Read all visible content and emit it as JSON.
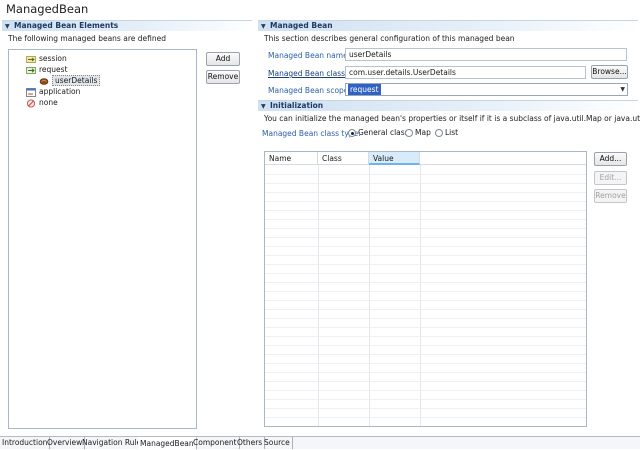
{
  "editor": {
    "title": "ManagedBean"
  },
  "left_section": {
    "header": "Managed Bean Elements",
    "description": "The following managed beans are defined",
    "tree": [
      {
        "label": "session",
        "icon": "session-scope-icon"
      },
      {
        "label": "request",
        "icon": "request-scope-icon"
      },
      {
        "label": "userDetails",
        "icon": "bean-icon"
      },
      {
        "label": "application",
        "icon": "application-scope-icon"
      },
      {
        "label": "none",
        "icon": "none-scope-icon"
      }
    ],
    "add_label": "Add",
    "remove_label": "Remove"
  },
  "managed_bean": {
    "header": "Managed Bean",
    "description": "This section describes general configuration of this managed bean",
    "name_label": "Managed Bean name*:",
    "name_value": "userDetails",
    "class_label": "Managed Bean class*:",
    "class_value": "com.user.details.UserDetails",
    "browse_label": "Browse...",
    "scope_label": "Managed Bean scope*:",
    "scope_value": "request"
  },
  "initialization": {
    "header": "Initialization",
    "description": "You can initialize the managed bean's properties or itself if it is a subclass of java.util.Map or java.util.List",
    "class_type_label": "Managed Bean class type:",
    "options": [
      "General class",
      "Map",
      "List"
    ],
    "selected_option": "General class",
    "columns": [
      "Name",
      "Class",
      "Value"
    ],
    "add_label": "Add...",
    "edit_label": "Edit...",
    "remove_label": "Remove"
  },
  "tabs": [
    "Introduction",
    "Overview",
    "Navigation Rule",
    "ManagedBean",
    "Component",
    "Others",
    "Source"
  ],
  "active_tab": "ManagedBean",
  "colors": {
    "section_header_text": "#1f3a63",
    "field_label": "#2a5ea8",
    "selection": "#3062c4"
  }
}
